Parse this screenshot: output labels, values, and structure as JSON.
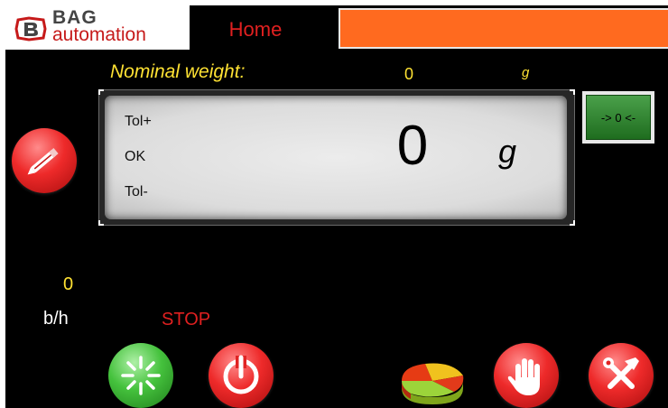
{
  "header": {
    "logo_word_1": "BAG",
    "logo_word_2": "automation",
    "home_tab_label": "Home"
  },
  "nominal": {
    "label": "Nominal weight:",
    "value": "0",
    "unit": "g"
  },
  "display": {
    "tol_plus_label": "Tol+",
    "ok_label": "OK",
    "tol_minus_label": "Tol-",
    "weight_value": "0",
    "weight_unit": "g"
  },
  "zero_button": {
    "label": "-> 0 <-"
  },
  "rate": {
    "value": "0",
    "unit": "b/h"
  },
  "status": {
    "text": "STOP"
  },
  "icons": {
    "edit": "pen-icon",
    "start": "sparkle-icon",
    "stop": "power-icon",
    "statistics": "pie-chart-icon",
    "hand": "hand-icon",
    "tools": "tools-icon"
  },
  "colors": {
    "background": "#000000",
    "accent_orange": "#ff6a1f",
    "label_yellow": "#ffe233",
    "status_red": "#e02020",
    "zero_button_green": "#2f8a2f"
  }
}
